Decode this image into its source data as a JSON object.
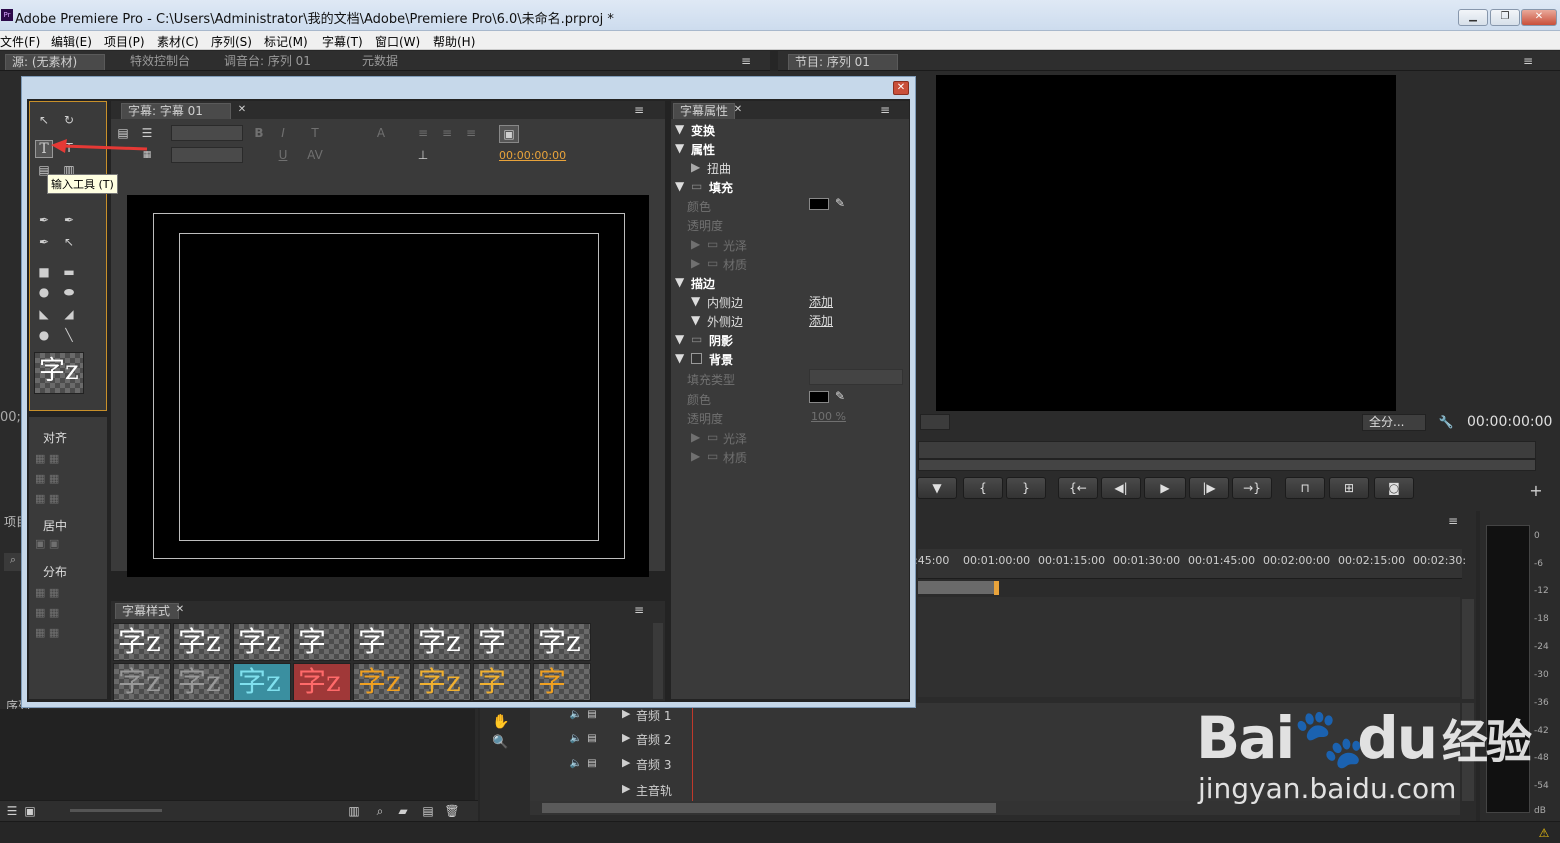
{
  "app": {
    "logo": "Pr",
    "title": "Adobe Premiere Pro - C:\\Users\\Administrator\\我的文档\\Adobe\\Premiere Pro\\6.0\\未命名.prproj *"
  },
  "menu": [
    "文件(F)",
    "编辑(E)",
    "项目(P)",
    "素材(C)",
    "序列(S)",
    "标记(M)",
    "字幕(T)",
    "窗口(W)",
    "帮助(H)"
  ],
  "top_tabs": {
    "source": "源: (无素材)",
    "effect_controls": "特效控制台",
    "audio_mixer": "调音台: 序列 01",
    "metadata": "元数据",
    "program": "节目: 序列 01"
  },
  "title_dialog": {
    "title_tab": "字幕: 字幕 01",
    "timecode": "00:00:00:00",
    "tooltip": "输入工具 (T)",
    "tools_sample": "字z",
    "align_label": "对齐",
    "center_label": "居中",
    "distribute_label": "分布",
    "styles_tab": "字幕样式",
    "style_thumbs": [
      "字z",
      "字z",
      "字z",
      "字",
      "字",
      "字z",
      "字",
      "字z",
      "字z",
      "字z",
      "字z",
      "字z",
      "字z",
      "字z",
      "字",
      "字"
    ],
    "props_tab": "字幕属性",
    "props": {
      "transform": "变换",
      "attributes": "属性",
      "distort": "扭曲",
      "fill": "填充",
      "color": "颜色",
      "opacity": "透明度",
      "sheen": "光泽",
      "texture": "材质",
      "stroke": "描边",
      "inner_stroke": "内侧边",
      "outer_stroke": "外侧边",
      "add": "添加",
      "shadow": "阴影",
      "background": "背景",
      "fill_type": "填充类型",
      "bg_color": "颜色",
      "bg_opacity": "透明度",
      "bg_opacity_value": "100 %",
      "bg_sheen": "光泽",
      "bg_texture": "材质"
    }
  },
  "program": {
    "zoom": "全分...",
    "timecode": "00:00:00:00"
  },
  "timeline": {
    "ruler": [
      ":45:00",
      "00:01:00:00",
      "00:01:15:00",
      "00:01:30:00",
      "00:01:45:00",
      "00:02:00:00",
      "00:02:15:00",
      "00:02:30:"
    ],
    "audio_tracks": [
      "音频 1",
      "音频 2",
      "音频 3",
      "主音轨"
    ]
  },
  "vu_scale": [
    "0",
    "-6",
    "-12",
    "-18",
    "-24",
    "-30",
    "-36",
    "-42",
    "-48",
    "-54",
    "dB"
  ],
  "left_panels": {
    "project_tab": "项目",
    "sequence_tab": "序列",
    "left_tc": "00;"
  },
  "watermark": {
    "brand": "Bai",
    "brand2": "du",
    "brand_cn": "经验",
    "url": "jingyan.baidu.com"
  },
  "colors": {
    "accent_orange": "#e8a33b",
    "arrow_red": "#e53935",
    "dialog_frame": "#c6d8ea"
  }
}
